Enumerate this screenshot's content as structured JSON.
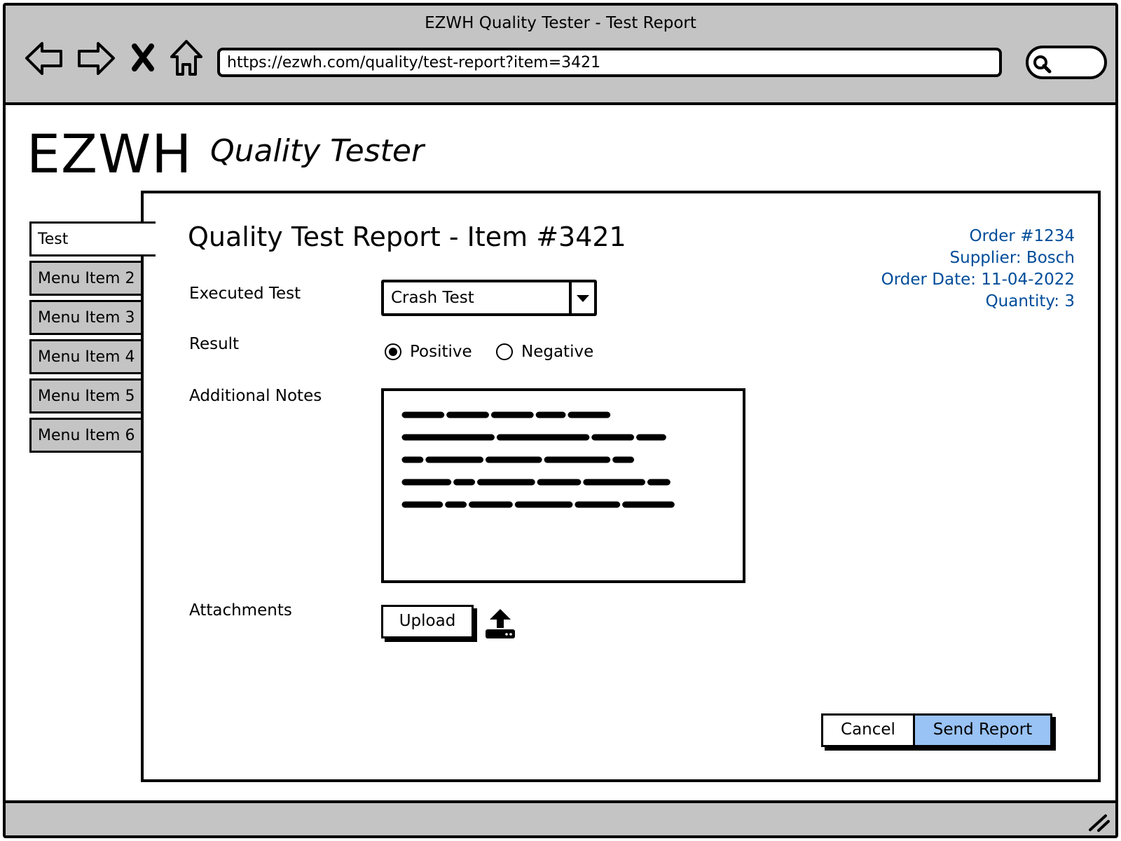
{
  "browser": {
    "title": "EZWH Quality Tester - Test Report",
    "url": "https://ezwh.com/quality/test-report?item=3421",
    "nav_icons": [
      "back-arrow-icon",
      "forward-arrow-icon",
      "stop-icon",
      "home-icon"
    ],
    "search_icon": "search-icon"
  },
  "header": {
    "logo": "EZWH",
    "subtitle": "Quality Tester"
  },
  "sidebar": {
    "items": [
      {
        "label": "Test",
        "active": true
      },
      {
        "label": "Menu Item 2",
        "active": false
      },
      {
        "label": "Menu Item 3",
        "active": false
      },
      {
        "label": "Menu Item 4",
        "active": false
      },
      {
        "label": "Menu Item 5",
        "active": false
      },
      {
        "label": "Menu Item 6",
        "active": false
      }
    ]
  },
  "report": {
    "title": "Quality Test Report - Item #3421",
    "order_info": {
      "order": "Order #1234",
      "supplier": "Supplier: Bosch",
      "order_date": "Order Date: 11-04-2022",
      "quantity": "Quantity: 3"
    },
    "fields": {
      "executed_test_label": "Executed Test",
      "executed_test_value": "Crash Test",
      "result_label": "Result",
      "result_options": [
        {
          "label": "Positive",
          "checked": true
        },
        {
          "label": "Negative",
          "checked": false
        }
      ],
      "notes_label": "Additional Notes",
      "attachments_label": "Attachments",
      "upload_label": "Upload"
    },
    "actions": {
      "cancel_label": "Cancel",
      "send_label": "Send Report"
    }
  },
  "colors": {
    "chrome_gray": "#c4c4c4",
    "order_info_blue": "#004c99",
    "primary_button": "#99c2f5"
  }
}
